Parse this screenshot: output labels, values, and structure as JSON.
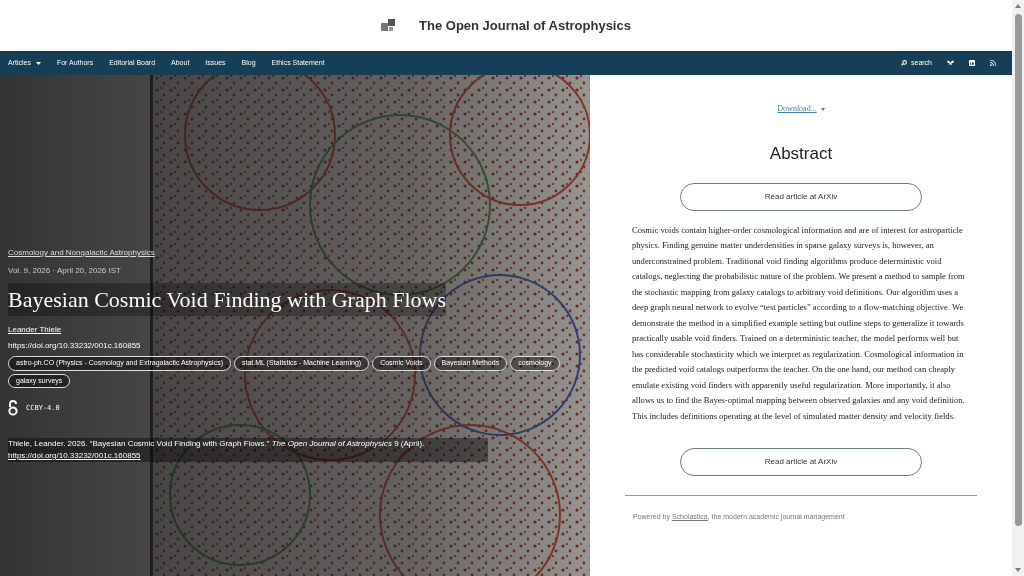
{
  "header": {
    "title": "The Open Journal of Astrophysics"
  },
  "nav": {
    "items": [
      {
        "label": "Articles",
        "dropdown": true
      },
      {
        "label": "For Authors",
        "dropdown": false
      },
      {
        "label": "Editorial Board",
        "dropdown": false
      },
      {
        "label": "About",
        "dropdown": false
      },
      {
        "label": "Issues",
        "dropdown": false
      },
      {
        "label": "Blog",
        "dropdown": false
      },
      {
        "label": "Ethics Statement",
        "dropdown": false
      }
    ],
    "search": "search"
  },
  "article": {
    "category": "Cosmology and Nongalactic Astrophysics",
    "meta": "Vol. 9, 2026 · April 20, 2026 IST",
    "title": "Bayesian Cosmic Void Finding with Graph Flows",
    "author": "Leander Thiele",
    "doi": "https://doi.org/10.33232/001c.160855",
    "tags": [
      "astro-ph.CO (Physics - Cosmology and Extragalactic Astrophysics)",
      "stat.ML (Statistics - Machine Learning)",
      "Cosmic Voids",
      "Bayesian Methods",
      "cosmology",
      "galaxy surveys"
    ],
    "license": "CCBY-4.0",
    "citation": {
      "text": "Thiele, Leander. 2026. “Bayesian Cosmic Void Finding with Graph Flows.” *The Open Journal of Astrophysics* 9 (April).",
      "link": "https://doi.org/10.33232/001c.160855"
    }
  },
  "abstract": {
    "download": "Download...",
    "heading": "Abstract",
    "buttons": [
      "Read article at ArXiv",
      "Read article at ArXiv"
    ],
    "text": "Cosmic voids contain higher-order cosmological information and are of interest for astroparticle physics. Finding genuine matter underdensities in sparse galaxy surveys is, however, an underconstrained problem. Traditional void finding algorithms produce deterministic void catalogs, neglecting the probabilistic nature of the problem. We present a method to sample from the stochastic mapping from galaxy catalogs to arbitrary void definitions. Our algorithm uses a deep graph neural network to evolve “test particles” according to a flow-matching objective. We demonstrate the method in a simplified example setting but outline steps to generalize it towards practically usable void finders. Trained on a deterministic teacher, the model performs well but has considerable stochasticity which we interpret as regularization. Cosmological information in the predicted void catalogs outperforms the teacher. On the one hand, our method can cheaply emulate existing void finders with apparently useful regularization. More importantly, it also allows us to find the Bayes-optimal mapping between observed galaxies and any void definition. This includes definitions operating at the level of simulated matter density and velocity fields."
  },
  "footer": {
    "before": "Powered by ",
    "link": "Scholastica",
    "after": ", the modern academic journal management"
  }
}
